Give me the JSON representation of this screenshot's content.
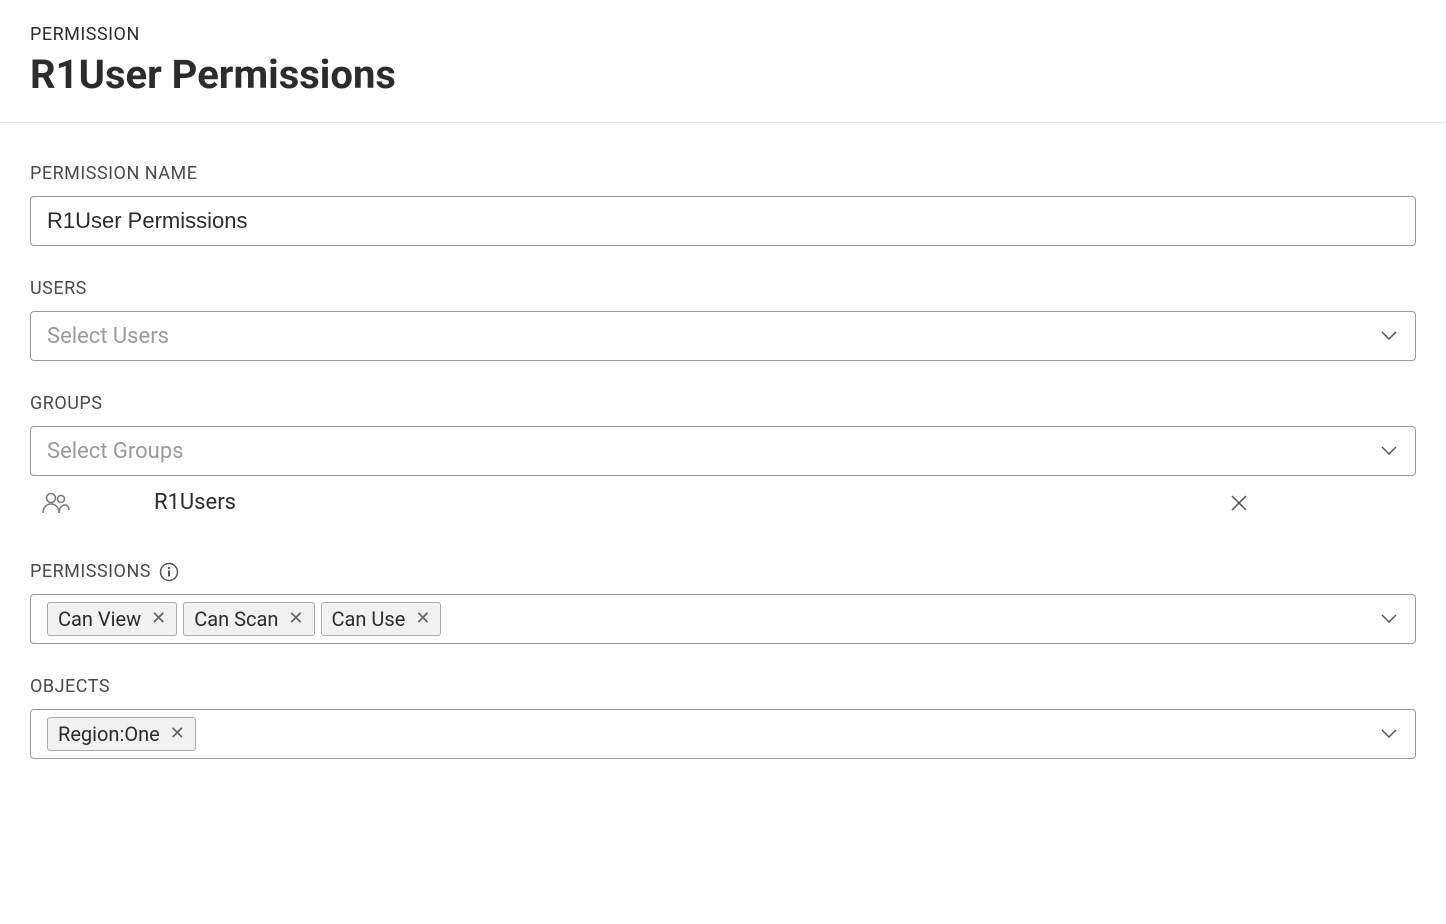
{
  "header": {
    "eyebrow": "PERMISSION",
    "title": "R1User Permissions"
  },
  "fields": {
    "permission_name": {
      "label": "PERMISSION NAME",
      "value": "R1User Permissions"
    },
    "users": {
      "label": "USERS",
      "placeholder": "Select Users"
    },
    "groups": {
      "label": "GROUPS",
      "placeholder": "Select Groups",
      "selected": [
        {
          "name": "R1Users"
        }
      ]
    },
    "permissions": {
      "label": "PERMISSIONS",
      "tags": [
        {
          "label": "Can View"
        },
        {
          "label": "Can Scan"
        },
        {
          "label": "Can Use"
        }
      ]
    },
    "objects": {
      "label": "OBJECTS",
      "tags": [
        {
          "label": "Region:One"
        }
      ]
    }
  }
}
